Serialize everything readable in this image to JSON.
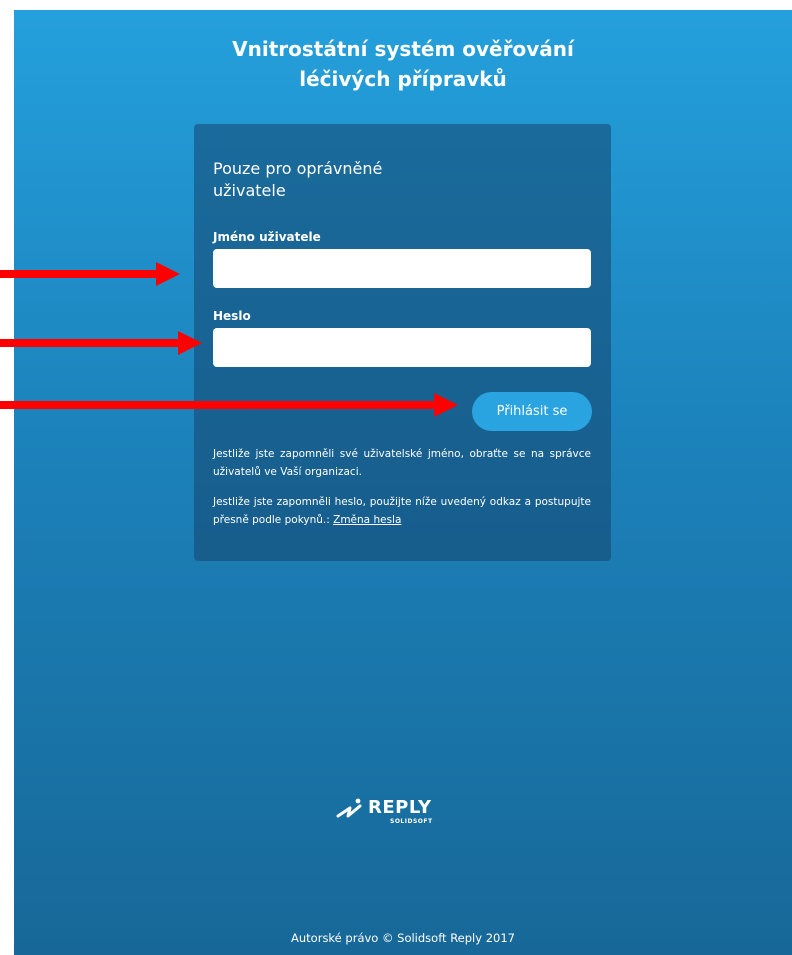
{
  "page": {
    "title_line1": "Vnitrostátní systém ověřování",
    "title_line2": "léčivých přípravků"
  },
  "login": {
    "heading": "Pouze pro oprávněné uživatele",
    "username_label": "Jméno uživatele",
    "username_value": "",
    "password_label": "Heslo",
    "password_value": "",
    "submit_label": "Přihlásit se",
    "help_username": "Jestliže jste zapomněli své uživatelské jméno, obraťte se na správce uživatelů ve Vaší organizaci.",
    "help_password_prefix": "Jestliže jste zapomněli heslo, použijte níže uvedený odkaz a postupujte přesně podle pokynů.: ",
    "change_password_link": "Změna hesla"
  },
  "footer": {
    "logo_brand": "REPLY",
    "logo_sub": "SOLIDSOFT",
    "copyright": "Autorské právo © Solidsoft Reply 2017"
  },
  "colors": {
    "background_top": "#24a0dc",
    "background_bottom": "#176898",
    "button": "#2aa4e0",
    "annotation_arrow": "#ff0000"
  },
  "icons": {
    "logo": "reply-logo-icon",
    "annotation": "red-arrow-icon"
  }
}
